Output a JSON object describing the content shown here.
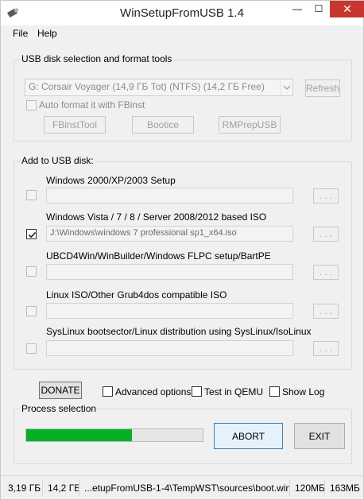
{
  "window": {
    "title": "WinSetupFromUSB 1.4",
    "close_glyph": "✕",
    "min_glyph": "—",
    "max_glyph": "☐"
  },
  "menu": {
    "items": [
      "File",
      "Help"
    ]
  },
  "usb_group": {
    "title": "USB disk selection and format tools",
    "disk_value": "G: Corsair Voyager (14,9 ГБ Tot) (NTFS) (14,2 ГБ Free)",
    "refresh_label": "Refresh",
    "auto_format_label": "Auto format it with FBinst",
    "auto_format_checked": false,
    "tools": [
      "FBinstTool",
      "Bootice",
      "RMPrepUSB"
    ]
  },
  "add_group": {
    "title": "Add to USB disk:",
    "browse_label": ". . .",
    "sources": [
      {
        "label": "Windows 2000/XP/2003 Setup",
        "path": "",
        "checked": false
      },
      {
        "label": "Windows Vista / 7 / 8 / Server 2008/2012 based ISO",
        "path": "J:\\Windows\\windows 7 professional sp1_x64.iso",
        "checked": true
      },
      {
        "label": "UBCD4Win/WinBuilder/Windows FLPC setup/BartPE",
        "path": "",
        "checked": false
      },
      {
        "label": "Linux ISO/Other Grub4dos compatible ISO",
        "path": "",
        "checked": false
      },
      {
        "label": "SysLinux bootsector/Linux distribution using SysLinux/IsoLinux",
        "path": "",
        "checked": false
      }
    ]
  },
  "options": {
    "donate_label": "DONATE",
    "advanced_label": "Advanced options",
    "qemu_label": "Test in QEMU",
    "showlog_label": "Show Log",
    "advanced_checked": false,
    "qemu_checked": false,
    "showlog_checked": false
  },
  "process": {
    "title": "Process selection",
    "progress_fraction": 0.6,
    "progress_color": "#06b025",
    "abort_label": "ABORT",
    "exit_label": "EXIT"
  },
  "status": {
    "total": "3,19 ГБ",
    "free": "14,2 ГБ",
    "file": "...etupFromUSB-1-4\\TempWST\\sources\\boot.win",
    "size1": "120МБ",
    "size2": "163МБ"
  }
}
